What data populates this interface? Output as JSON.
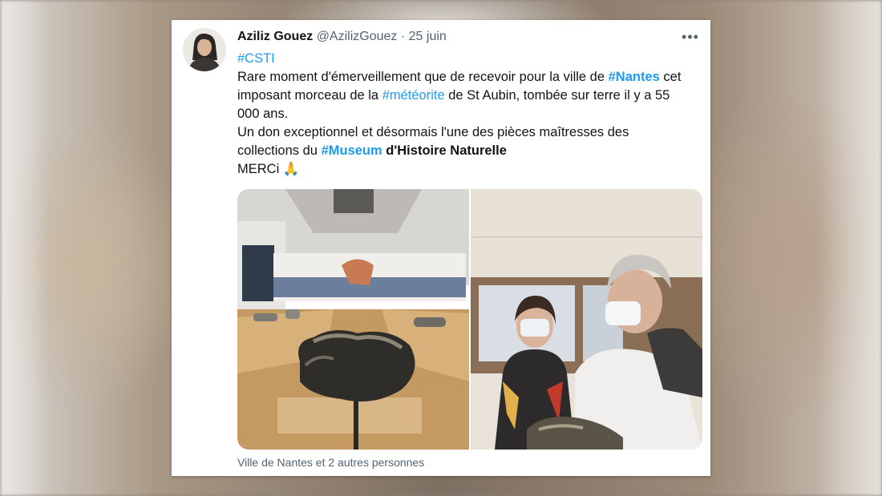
{
  "tweet": {
    "author_name": "Aziliz Gouez",
    "handle": "@AzilizGouez",
    "separator": "·",
    "date": "25 juin",
    "more_label": "•••",
    "hashtag_line": "#CSTI",
    "text": {
      "l1_a": "Rare moment d'émerveillement que de recevoir pour la ville de ",
      "l1_tag": "#Nantes",
      "l1_b": " cet",
      "l2_a": "imposant morceau de la ",
      "l2_tag": "#météorite",
      "l2_b": " de St Aubin, tombée sur terre il y a 55",
      "l3": "000 ans.",
      "l4": "Un don exceptionnel et désormais l'une des pièces maîtresses des",
      "l5_a": "collections du ",
      "l5_tag": "#Museum",
      "l5_b": "d'Histoire Naturelle",
      "l6": "MERCi",
      "emoji": "🙏"
    },
    "media_tag_caption": "Ville de Nantes et 2 autres personnes"
  },
  "colors": {
    "link": "#1d9bf0",
    "text": "#0f1419",
    "muted": "#536471"
  },
  "icons": [
    "more-options-icon",
    "praying-hands-emoji"
  ]
}
